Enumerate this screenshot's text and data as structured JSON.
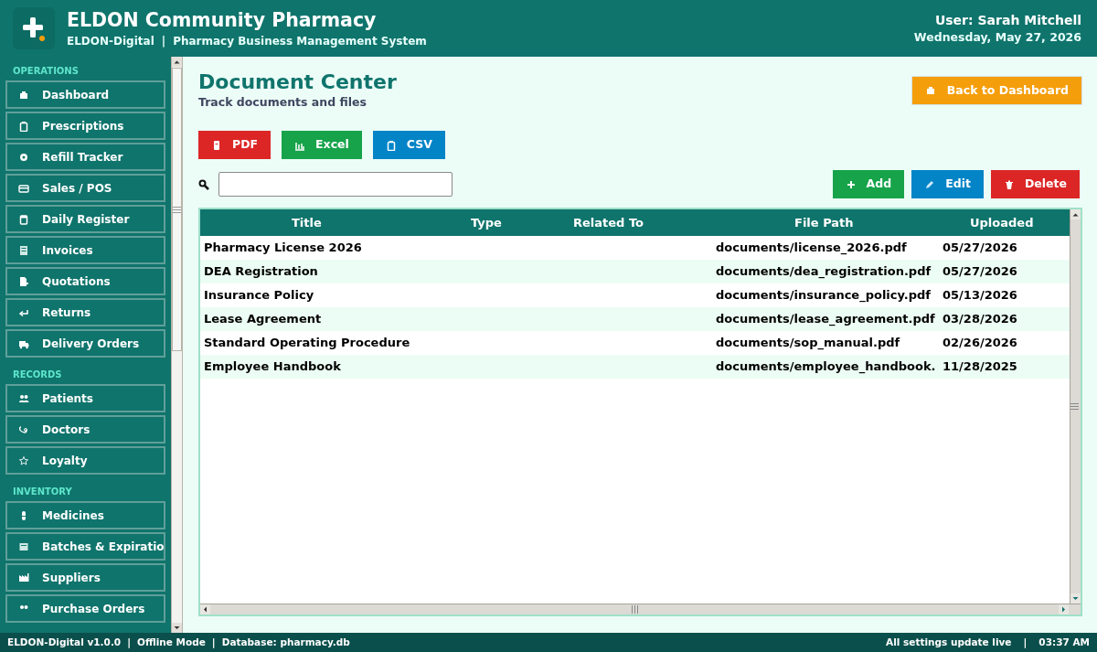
{
  "header": {
    "title": "ELDON Community Pharmacy",
    "subtitle_brand": "ELDON-Digital",
    "subtitle_separator": "|",
    "subtitle_system": "Pharmacy Business Management System",
    "user": "User: Sarah Mitchell",
    "date": "Wednesday, May 27, 2026"
  },
  "sidebar": {
    "sections": [
      {
        "heading": "OPERATIONS",
        "items": [
          {
            "label": "Dashboard"
          },
          {
            "label": "Prescriptions"
          },
          {
            "label": "Refill Tracker"
          },
          {
            "label": "Sales / POS"
          },
          {
            "label": "Daily Register"
          },
          {
            "label": "Invoices"
          },
          {
            "label": "Quotations"
          },
          {
            "label": "Returns"
          },
          {
            "label": "Delivery Orders"
          }
        ]
      },
      {
        "heading": "RECORDS",
        "items": [
          {
            "label": "Patients"
          },
          {
            "label": "Doctors"
          },
          {
            "label": "Loyalty"
          }
        ]
      },
      {
        "heading": "INVENTORY",
        "items": [
          {
            "label": "Medicines"
          },
          {
            "label": "Batches & Expiratio"
          },
          {
            "label": "Suppliers"
          },
          {
            "label": "Purchase Orders"
          }
        ]
      }
    ]
  },
  "page": {
    "title": "Document Center",
    "subtitle": "Track documents and files",
    "back_button": "Back to Dashboard"
  },
  "export_buttons": [
    {
      "label": "PDF",
      "kind": "pdf"
    },
    {
      "label": "Excel",
      "kind": "excel"
    },
    {
      "label": "CSV",
      "kind": "csv"
    }
  ],
  "action_buttons": [
    {
      "label": "Add",
      "kind": "add"
    },
    {
      "label": "Edit",
      "kind": "edit"
    },
    {
      "label": "Delete",
      "kind": "delete"
    }
  ],
  "table": {
    "columns": [
      "Title",
      "Type",
      "Related To",
      "File Path",
      "Uploaded"
    ],
    "rows": [
      [
        "Pharmacy License 2026",
        "",
        "",
        "documents/license_2026.pdf",
        "05/27/2026"
      ],
      [
        "DEA Registration",
        "",
        "",
        "documents/dea_registration.pdf",
        "05/27/2026"
      ],
      [
        "Insurance Policy",
        "",
        "",
        "documents/insurance_policy.pdf",
        "05/13/2026"
      ],
      [
        "Lease Agreement",
        "",
        "",
        "documents/lease_agreement.pdf",
        "03/28/2026"
      ],
      [
        "Standard Operating Procedure",
        "",
        "",
        "documents/sop_manual.pdf",
        "02/26/2026"
      ],
      [
        "Employee Handbook",
        "",
        "",
        "documents/employee_handbook.",
        "11/28/2025"
      ]
    ]
  },
  "status_bar": {
    "version": "ELDON-Digital v1.0.0",
    "mode": "Offline Mode",
    "database": "Database: pharmacy.db",
    "separators": [
      "|",
      "|",
      "|"
    ],
    "live": "All settings update live",
    "time": "03:37 AM"
  }
}
